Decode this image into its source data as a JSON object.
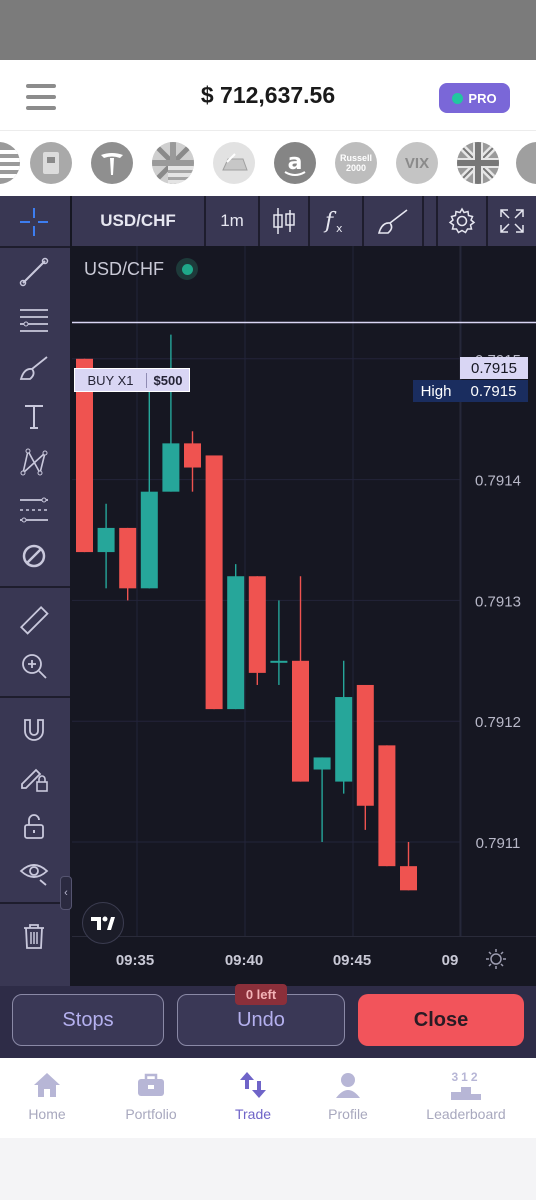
{
  "header": {
    "balance": "$ 712,637.56",
    "pro_label": "PRO"
  },
  "assets": [
    "Russell 2000",
    "VIX"
  ],
  "chart_toolbar": {
    "symbol": "USD/CHF",
    "interval": "1m"
  },
  "chart_legend": {
    "symbol": "USD/CHF"
  },
  "price_labels": [
    "0.7916",
    "0.7915",
    "0.7914",
    "0.7913",
    "0.7912",
    "0.7911"
  ],
  "order_line": {
    "label": "BUY X1",
    "amount": "$500",
    "price": "0.7915"
  },
  "high_marker": {
    "label": "High",
    "price": "0.7915"
  },
  "time_labels": [
    "09:35",
    "09:40",
    "09:45",
    "09"
  ],
  "chart_data": {
    "type": "candlestick",
    "ylim": [
      0.79105,
      0.79166
    ],
    "candles": [
      {
        "time": "09:33",
        "open": 0.7915,
        "high": 0.7915,
        "low": 0.79134,
        "close": 0.79134
      },
      {
        "time": "09:34",
        "open": 0.79134,
        "high": 0.79138,
        "low": 0.79131,
        "close": 0.79136
      },
      {
        "time": "09:34",
        "open": 0.79136,
        "high": 0.79136,
        "low": 0.7913,
        "close": 0.79131
      },
      {
        "time": "09:35",
        "open": 0.79131,
        "high": 0.79148,
        "low": 0.79131,
        "close": 0.79139
      },
      {
        "time": "09:36",
        "open": 0.79139,
        "high": 0.79152,
        "low": 0.79139,
        "close": 0.79143
      },
      {
        "time": "09:37",
        "open": 0.79143,
        "high": 0.79144,
        "low": 0.79139,
        "close": 0.79141
      },
      {
        "time": "09:38",
        "open": 0.79142,
        "high": 0.79142,
        "low": 0.79121,
        "close": 0.79121
      },
      {
        "time": "09:39",
        "open": 0.79121,
        "high": 0.79133,
        "low": 0.79121,
        "close": 0.79132
      },
      {
        "time": "09:40",
        "open": 0.79132,
        "high": 0.79132,
        "low": 0.79123,
        "close": 0.79124
      },
      {
        "time": "09:41",
        "open": 0.79125,
        "high": 0.7913,
        "low": 0.79123,
        "close": 0.79125
      },
      {
        "time": "09:42",
        "open": 0.79125,
        "high": 0.79132,
        "low": 0.79115,
        "close": 0.79115
      },
      {
        "time": "09:43",
        "open": 0.79116,
        "high": 0.79117,
        "low": 0.7911,
        "close": 0.79117
      },
      {
        "time": "09:44",
        "open": 0.79115,
        "high": 0.79125,
        "low": 0.79114,
        "close": 0.79122
      },
      {
        "time": "09:45",
        "open": 0.79123,
        "high": 0.79123,
        "low": 0.79111,
        "close": 0.79113
      },
      {
        "time": "09:46",
        "open": 0.79118,
        "high": 0.79118,
        "low": 0.79108,
        "close": 0.79108
      },
      {
        "time": "09:47",
        "open": 0.79108,
        "high": 0.7911,
        "low": 0.79106,
        "close": 0.79106
      }
    ],
    "up_color": "#26a69a",
    "down_color": "#ef5350",
    "grid": true
  },
  "actions": {
    "stops": "Stops",
    "undo": "Undo",
    "undo_badge": "0 left",
    "close": "Close"
  },
  "nav": {
    "home": "Home",
    "portfolio": "Portfolio",
    "trade": "Trade",
    "profile": "Profile",
    "leaderboard": "Leaderboard",
    "leaderboard_rank_digits": "312"
  },
  "colors": {
    "accent": "#7a67d8",
    "terminal_bg": "#161722",
    "toolbar_bg": "#393753",
    "close_red": "#f2545b"
  }
}
